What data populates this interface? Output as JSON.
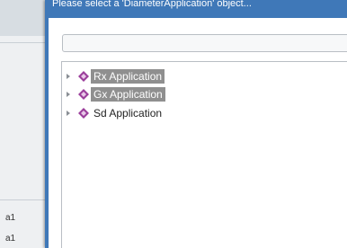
{
  "background_app": {
    "texts": [
      "a1",
      "a1"
    ]
  },
  "dialog": {
    "title": "Please select a 'DiameterApplication' object...",
    "filter": {
      "value": "",
      "placeholder": ""
    },
    "tree": {
      "items": [
        {
          "label": "Rx Application",
          "selected": true,
          "icon": "diamond-node-icon"
        },
        {
          "label": "Gx Application",
          "selected": true,
          "icon": "diamond-node-icon"
        },
        {
          "label": "Sd Application",
          "selected": false,
          "icon": "diamond-node-icon"
        }
      ]
    }
  },
  "colors": {
    "dialog_frame": "#3f78b8",
    "selection": "#8f8f8f",
    "node_icon": "#9b3f9b"
  }
}
